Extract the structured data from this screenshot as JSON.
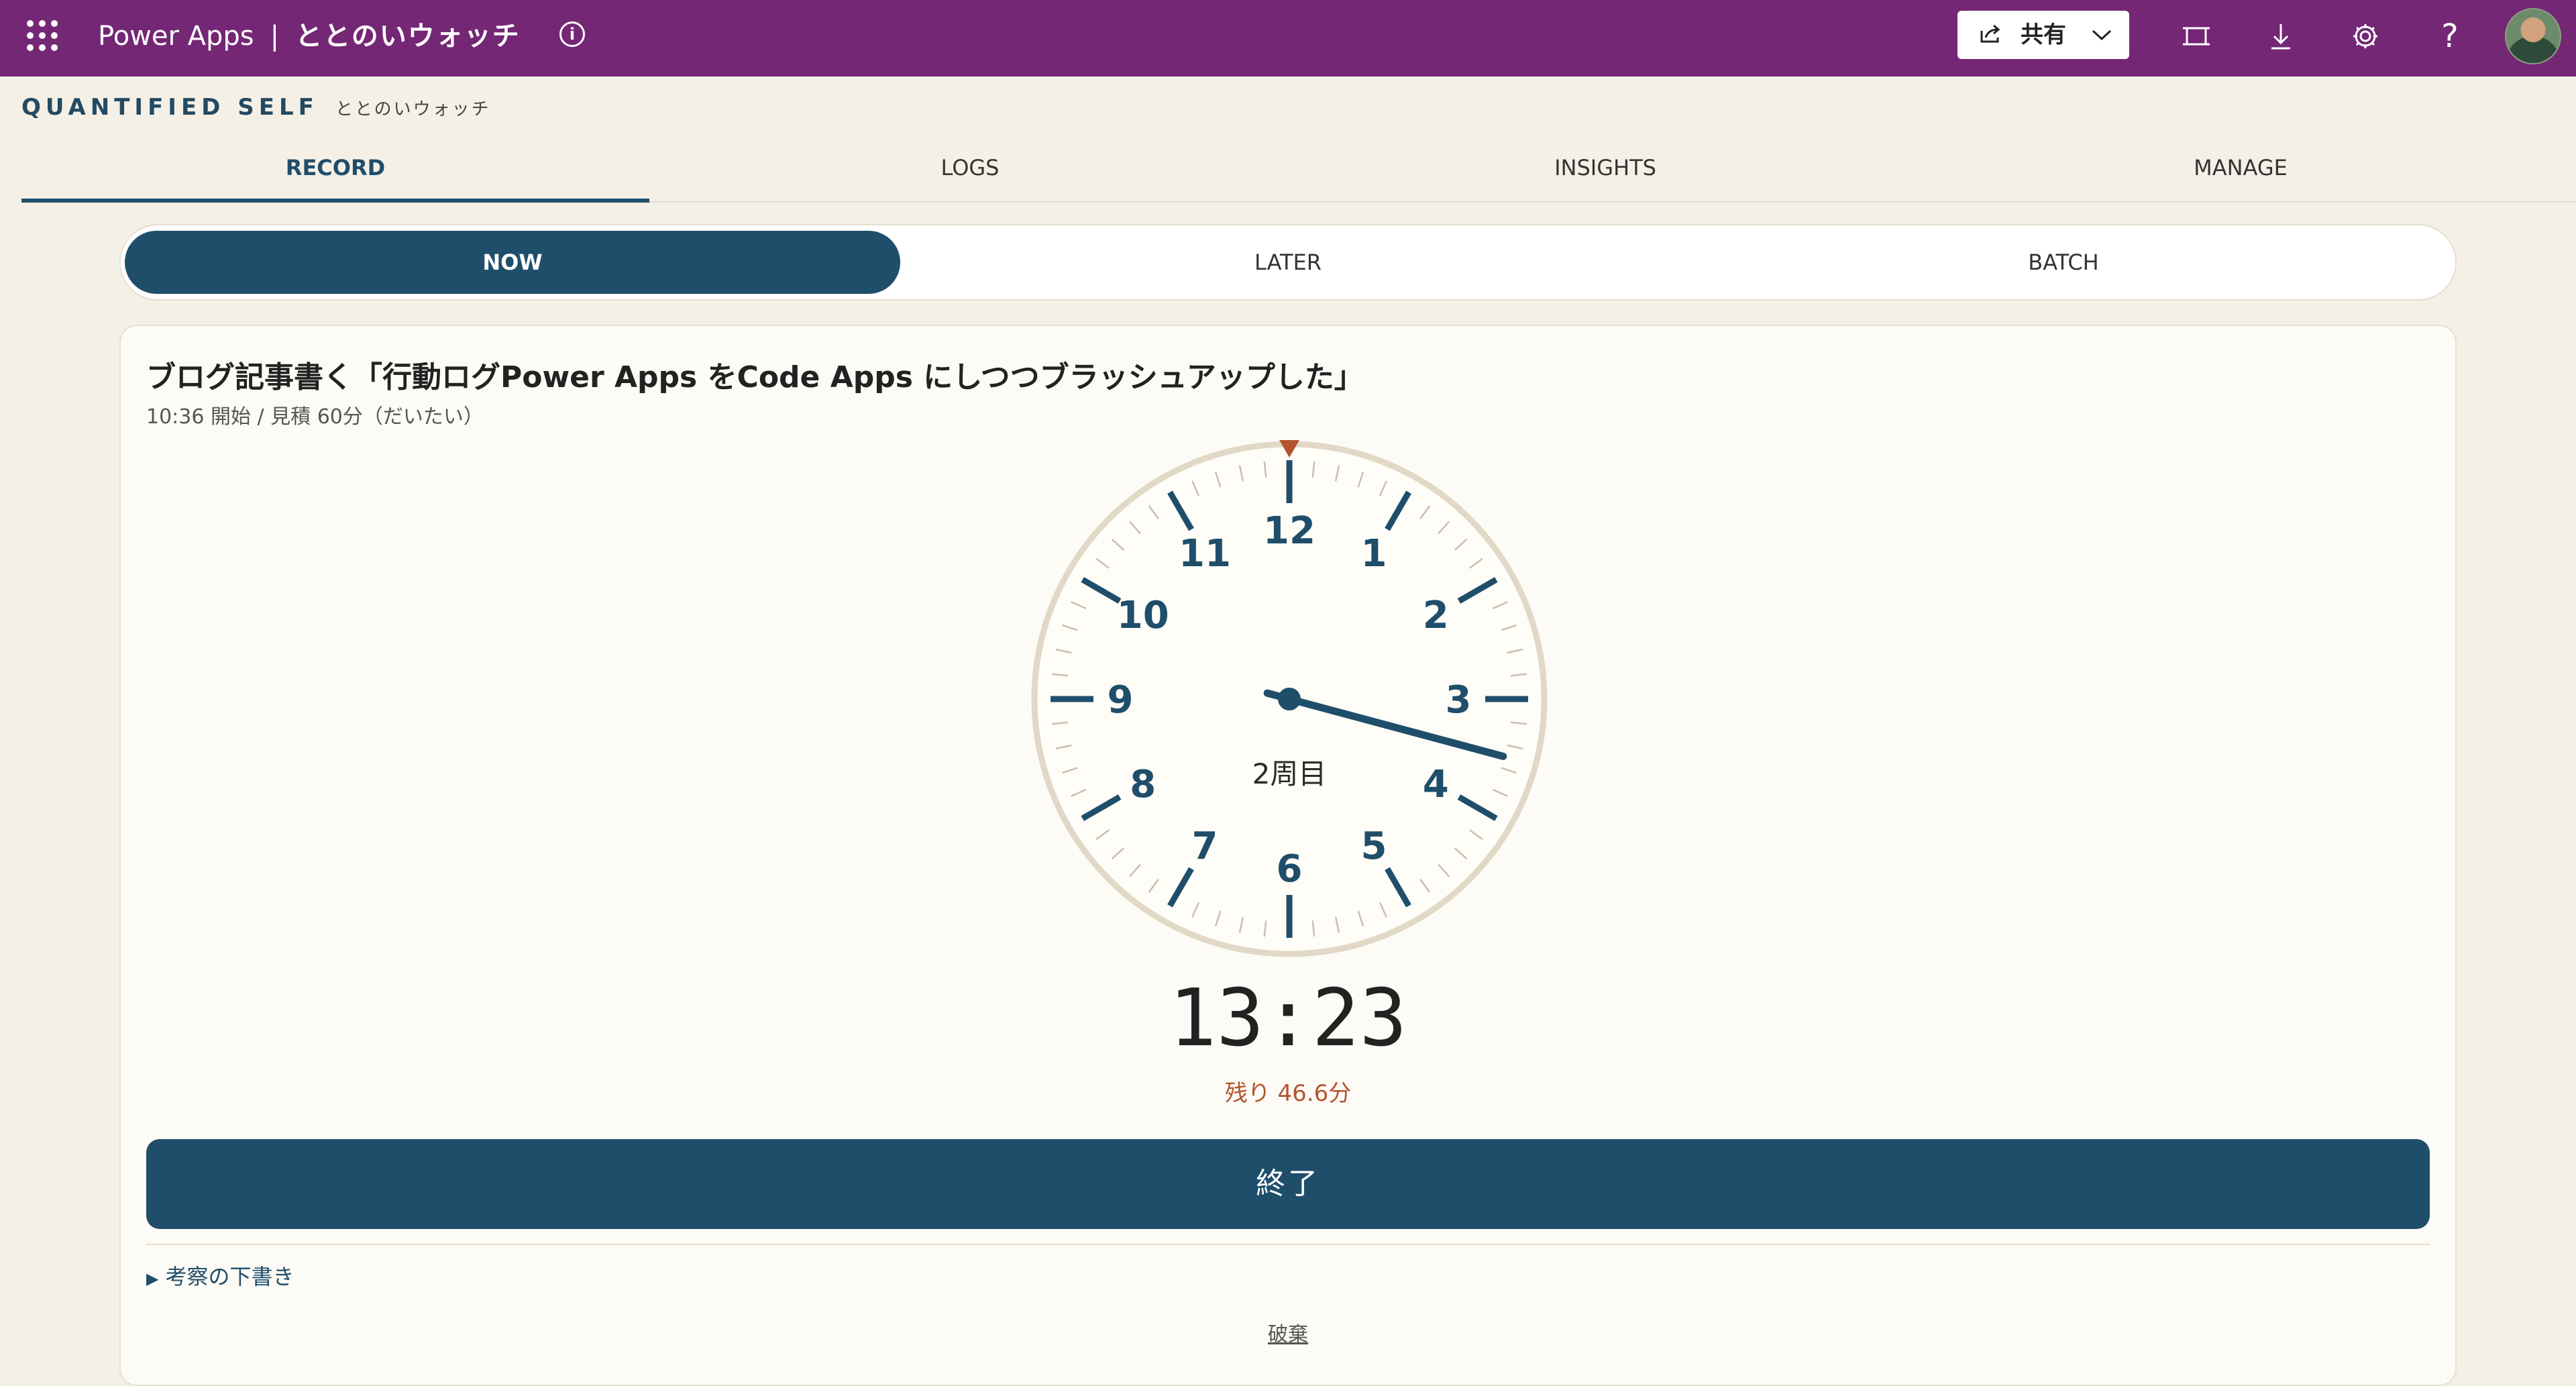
{
  "topbar": {
    "product": "Power Apps",
    "separator": "|",
    "app_name": "ととのいウォッチ",
    "share_label": "共有"
  },
  "header": {
    "title": "QUANTIFIED SELF",
    "subtitle": "ととのいウォッチ"
  },
  "tabs": [
    {
      "label": "RECORD",
      "active": true
    },
    {
      "label": "LOGS",
      "active": false
    },
    {
      "label": "INSIGHTS",
      "active": false
    },
    {
      "label": "MANAGE",
      "active": false
    }
  ],
  "modes": [
    {
      "label": "NOW",
      "active": true
    },
    {
      "label": "LATER",
      "active": false
    },
    {
      "label": "BATCH",
      "active": false
    }
  ],
  "task": {
    "title": "ブログ記事書く「行動ログPower Apps をCode Apps にしつつブラッシュアップした」",
    "meta": "10:36 開始 / 見積 60分（だいたい）"
  },
  "clock": {
    "numbers": [
      "12",
      "1",
      "2",
      "3",
      "4",
      "5",
      "6",
      "7",
      "8",
      "9",
      "10",
      "11"
    ],
    "lap_label": "2周目",
    "hand_minutes": 3.5
  },
  "timer": {
    "elapsed": "13:23",
    "remaining": "残り 46.6分"
  },
  "actions": {
    "finish": "終了",
    "drafts": "考察の下書き",
    "discard": "破棄"
  },
  "colors": {
    "topbar": "#742774",
    "accent": "#1f4e6b",
    "warning": "#b4532f",
    "background": "#f5f0e6"
  }
}
